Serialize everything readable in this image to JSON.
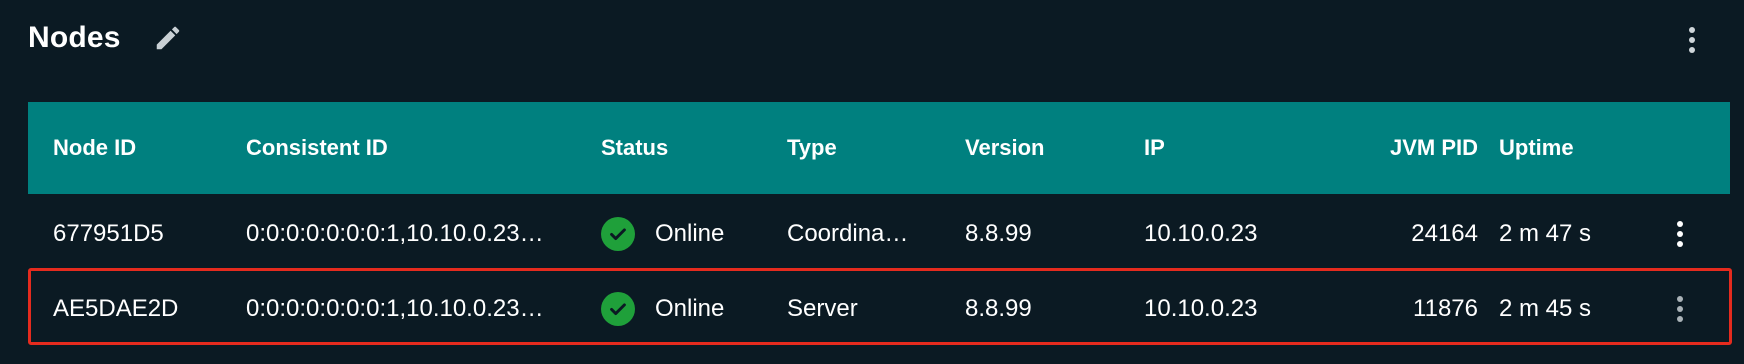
{
  "header": {
    "title": "Nodes"
  },
  "table": {
    "columns": {
      "node_id": "Node ID",
      "consistent_id": "Consistent ID",
      "status": "Status",
      "type": "Type",
      "version": "Version",
      "ip": "IP",
      "jvm_pid": "JVM PID",
      "uptime": "Uptime"
    },
    "rows": [
      {
        "node_id": "677951D5",
        "consistent_id": "0:0:0:0:0:0:0:1,10.10.0.23…",
        "status": "Online",
        "type": "Coordina…",
        "version": "8.8.99",
        "ip": "10.10.0.23",
        "jvm_pid": "24164",
        "uptime": "2 m 47 s",
        "selected": false
      },
      {
        "node_id": "AE5DAE2D",
        "consistent_id": "0:0:0:0:0:0:0:1,10.10.0.23…",
        "status": "Online",
        "type": "Server",
        "version": "8.8.99",
        "ip": "10.10.0.23",
        "jvm_pid": "11876",
        "uptime": "2 m 45 s",
        "selected": true
      }
    ]
  },
  "icons": {
    "edit": "pencil-icon",
    "menu": "more-vertical-icon",
    "status_online": "check-circle-icon"
  },
  "colors": {
    "background": "#0b1a23",
    "header_row": "#00807f",
    "status_online": "#1fa03a",
    "selection_outline": "#e52b1e"
  }
}
